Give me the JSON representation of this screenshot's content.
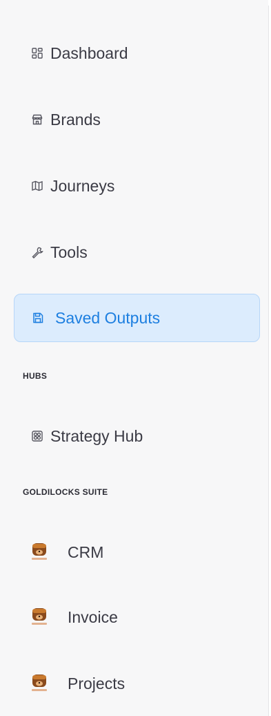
{
  "sidebar": {
    "nav": [
      {
        "label": "Dashboard",
        "icon": "dashboard-icon"
      },
      {
        "label": "Brands",
        "icon": "store-icon"
      },
      {
        "label": "Journeys",
        "icon": "map-icon"
      },
      {
        "label": "Tools",
        "icon": "wrench-icon"
      },
      {
        "label": "Saved Outputs",
        "icon": "save-icon",
        "active": true
      }
    ],
    "hubs_label": "HUBS",
    "hubs": [
      {
        "label": "Strategy Hub",
        "icon": "strategy-icon"
      }
    ],
    "suite_label": "GOLDILOCKS SUITE",
    "suite": [
      {
        "label": "CRM",
        "icon": "goldilocks-logo-icon"
      },
      {
        "label": "Invoice",
        "icon": "goldilocks-logo-icon"
      },
      {
        "label": "Projects",
        "icon": "goldilocks-logo-icon"
      }
    ],
    "colors": {
      "active_bg": "#dcecfd",
      "active_text": "#1d7fe0",
      "text": "#3b3b45"
    }
  }
}
